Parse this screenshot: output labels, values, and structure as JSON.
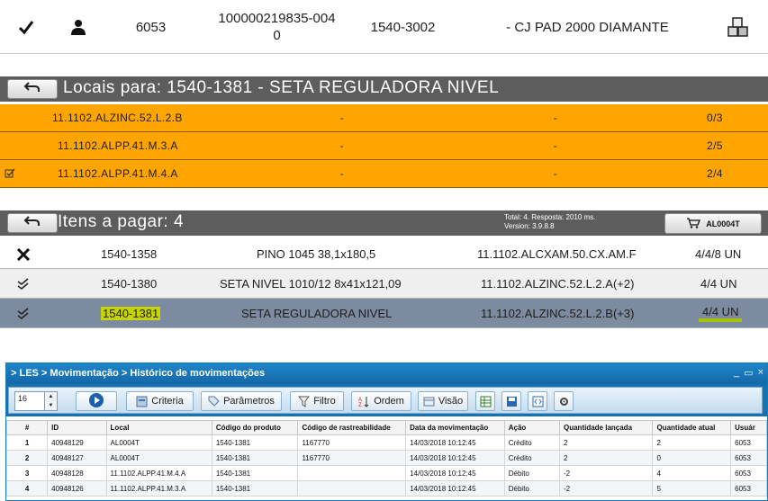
{
  "product_row": {
    "icons": [
      "checkmark-icon",
      "user-icon",
      "boxes-icon"
    ],
    "qty": "6053",
    "tracking_code": "100000219835-004\n0",
    "product_code": "1540-3002",
    "description": "- CJ PAD 2000 DIAMANTE"
  },
  "locais": {
    "title": "Locais para: 1540-1381 - SETA REGULADORA NIVEL",
    "rows": [
      {
        "address": "11.1102.ALZINC.52.L.2.B",
        "col2": "-",
        "col3": "-",
        "qty": "0/3",
        "checked": false
      },
      {
        "address": "11.1102.ALPP.41.M.3.A",
        "col2": "-",
        "col3": "-",
        "qty": "2/5",
        "checked": false
      },
      {
        "address": "11.1102.ALPP.41.M.4.A",
        "col2": "-",
        "col3": "-",
        "qty": "2/4",
        "checked": true
      }
    ]
  },
  "itens": {
    "title": "Itens a pagar: 4",
    "info_line1": "Total: 4. Resposta: 2010 ms.",
    "info_line2": "Version: 3.9.8.8",
    "pay_button": "AL0004T",
    "rows": [
      {
        "icon": "close-icon",
        "code": "1540-1358",
        "description": "PINO 1045 38,1x180,5",
        "location": "11.1102.ALCXAM.50.CX.AM.F",
        "qty": "4/4/8 UN"
      },
      {
        "icon": "double-check-icon",
        "code": "1540-1380",
        "description": "SETA NIVEL 1010/12 8x41x121,09",
        "location": "11.1102.ALZINC.52.L.2.A(+2)",
        "qty": "4/4 UN"
      },
      {
        "icon": "double-check-icon",
        "code": "1540-1381",
        "description": "SETA REGULADORA NIVEL",
        "location": "11.1102.ALZINC.52.L.2.B(+3)",
        "qty": "4/4 UN"
      }
    ]
  },
  "les": {
    "breadcrumb": "> LES > Movimentação > Histórico de movimentações",
    "window_controls": [
      "_",
      "▭",
      "×"
    ],
    "page_size": "16",
    "buttons": {
      "criteria": "Criteria",
      "parametros": "Parâmetros",
      "filtro": "Filtro",
      "ordem": "Ordem",
      "visao": "Visão"
    },
    "columns": [
      "#",
      "ID",
      "Local",
      "Código do produto",
      "Código de rastreabilidade",
      "Data da movimentação",
      "Ação",
      "Quantidade lançada",
      "Quantidade atual",
      "Usuár"
    ],
    "rows": [
      [
        "1",
        "40948129",
        "AL0004T",
        "1540-1381",
        "1167770",
        "14/03/2018 10:12:45",
        "Crédito",
        "2",
        "2",
        "6053"
      ],
      [
        "2",
        "40948127",
        "AL0004T",
        "1540-1381",
        "1167770",
        "14/03/2018 10:12:45",
        "Crédito",
        "2",
        "0",
        "6053"
      ],
      [
        "3",
        "40948128",
        "11.1102.ALPP.41.M.4.A",
        "1540-1381",
        "",
        "14/03/2018 10:12:45",
        "Débito",
        "-2",
        "4",
        "6053"
      ],
      [
        "4",
        "40948126",
        "11.1102.ALPP.41.M.3.A",
        "1540-1381",
        "",
        "14/03/2018 10:12:45",
        "Débito",
        "-2",
        "5",
        "6053"
      ]
    ]
  },
  "colors": {
    "orange": "#ffa500",
    "header_gray": "#5d5d5d",
    "selected_row": "#7c8b9f",
    "highlight": "#c6d400",
    "les_blue": "#1673b1"
  }
}
